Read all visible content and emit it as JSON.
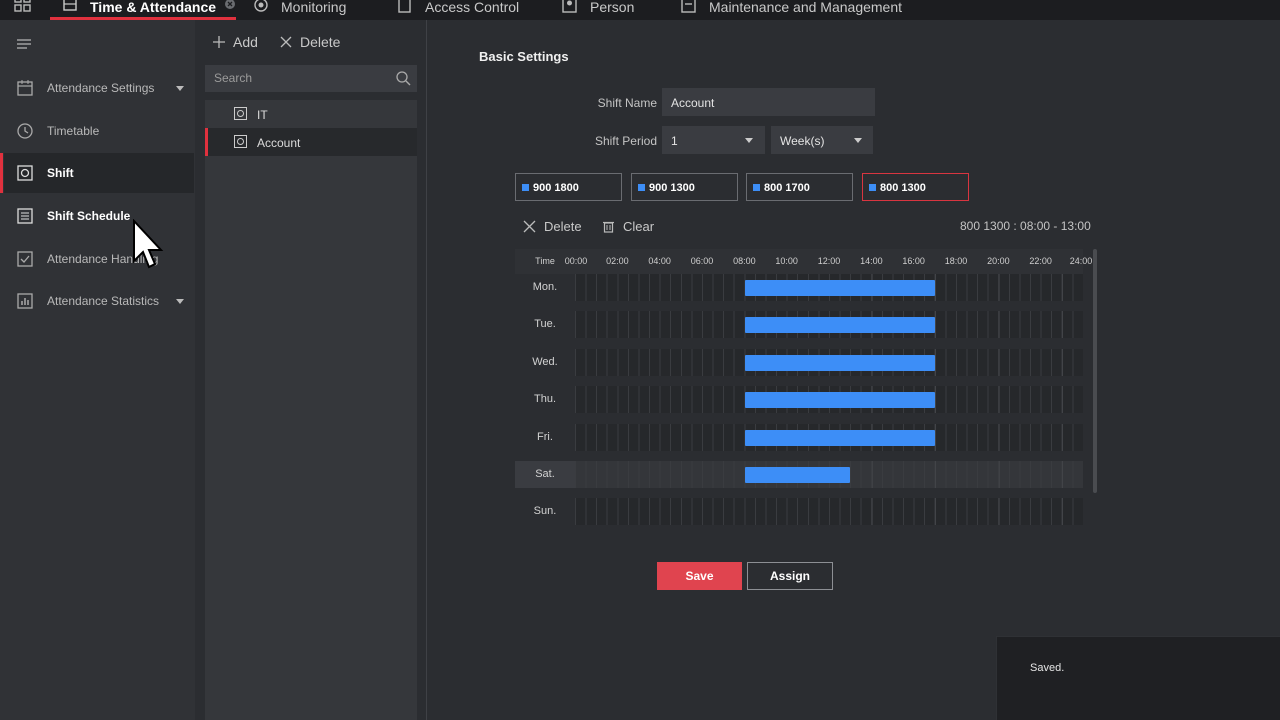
{
  "app": {
    "tabs": [
      {
        "label": "Time & Attendance",
        "active": true,
        "icon": "calendar-icon"
      },
      {
        "label": "Monitoring",
        "icon": "camera-icon"
      },
      {
        "label": "Access Control",
        "icon": "door-icon"
      },
      {
        "label": "Person",
        "icon": "person-icon"
      },
      {
        "label": "Maintenance and Management",
        "icon": "wrench-icon"
      }
    ]
  },
  "sidebar": {
    "items": [
      {
        "label": "Attendance Settings",
        "icon": "calendar-icon",
        "has_caret": true
      },
      {
        "label": "Timetable",
        "icon": "clock-icon"
      },
      {
        "label": "Shift",
        "icon": "shift-icon",
        "active": true
      },
      {
        "label": "Shift Schedule",
        "icon": "schedule-icon"
      },
      {
        "label": "Attendance Handling",
        "icon": "check-doc-icon"
      },
      {
        "label": "Attendance Statistics",
        "icon": "chart-icon",
        "has_caret": true
      }
    ]
  },
  "shift_list": {
    "add_label": "Add",
    "delete_label": "Delete",
    "search_placeholder": "Search",
    "items": [
      {
        "label": "IT"
      },
      {
        "label": "Account",
        "selected": true
      }
    ]
  },
  "basic_settings": {
    "title": "Basic Settings",
    "shift_name_label": "Shift Name",
    "shift_name_value": "Account",
    "shift_period_label": "Shift Period",
    "shift_period_value": "1",
    "shift_period_unit": "Week(s)"
  },
  "timetables": [
    {
      "label": "900 1800"
    },
    {
      "label": "900 1300"
    },
    {
      "label": "800 1700"
    },
    {
      "label": "800 1300",
      "selected": true
    }
  ],
  "schedule": {
    "delete_label": "Delete",
    "clear_label": "Clear",
    "info": "800 1300 : 08:00 - 13:00",
    "time_label": "Time",
    "ticks": [
      "00:00",
      "02:00",
      "04:00",
      "06:00",
      "08:00",
      "10:00",
      "12:00",
      "14:00",
      "16:00",
      "18:00",
      "20:00",
      "22:00",
      "24:00"
    ],
    "days": [
      {
        "label": "Mon.",
        "start": 8,
        "end": 17
      },
      {
        "label": "Tue.",
        "start": 8,
        "end": 17
      },
      {
        "label": "Wed.",
        "start": 8,
        "end": 17
      },
      {
        "label": "Thu.",
        "start": 8,
        "end": 17
      },
      {
        "label": "Fri.",
        "start": 8,
        "end": 17
      },
      {
        "label": "Sat.",
        "start": 8,
        "end": 13,
        "highlighted": true
      },
      {
        "label": "Sun."
      }
    ],
    "bar_color": "#3d8ef7"
  },
  "actions": {
    "save_label": "Save",
    "assign_label": "Assign"
  },
  "toast": {
    "message": "Saved."
  },
  "colors": {
    "accent": "#e0313e",
    "bar": "#3d8ef7"
  }
}
